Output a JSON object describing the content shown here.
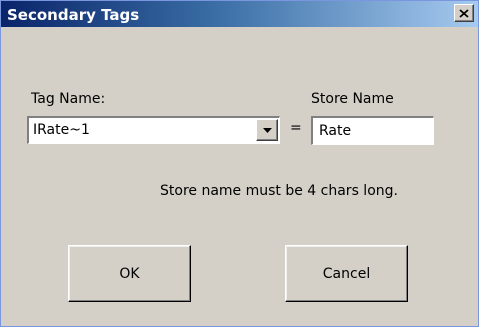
{
  "dialog": {
    "title": "Secondary Tags",
    "close_symbol": "✕"
  },
  "form": {
    "tag_name_label": "Tag Name:",
    "tag_name_value": "IRate~1",
    "equals": "=",
    "store_name_label": "Store Name",
    "store_name_value": "Rate",
    "hint": "Store name must be 4 chars long."
  },
  "buttons": {
    "ok": "OK",
    "cancel": "Cancel"
  },
  "icons": {
    "close": "close-icon",
    "dropdown": "chevron-down-icon"
  }
}
